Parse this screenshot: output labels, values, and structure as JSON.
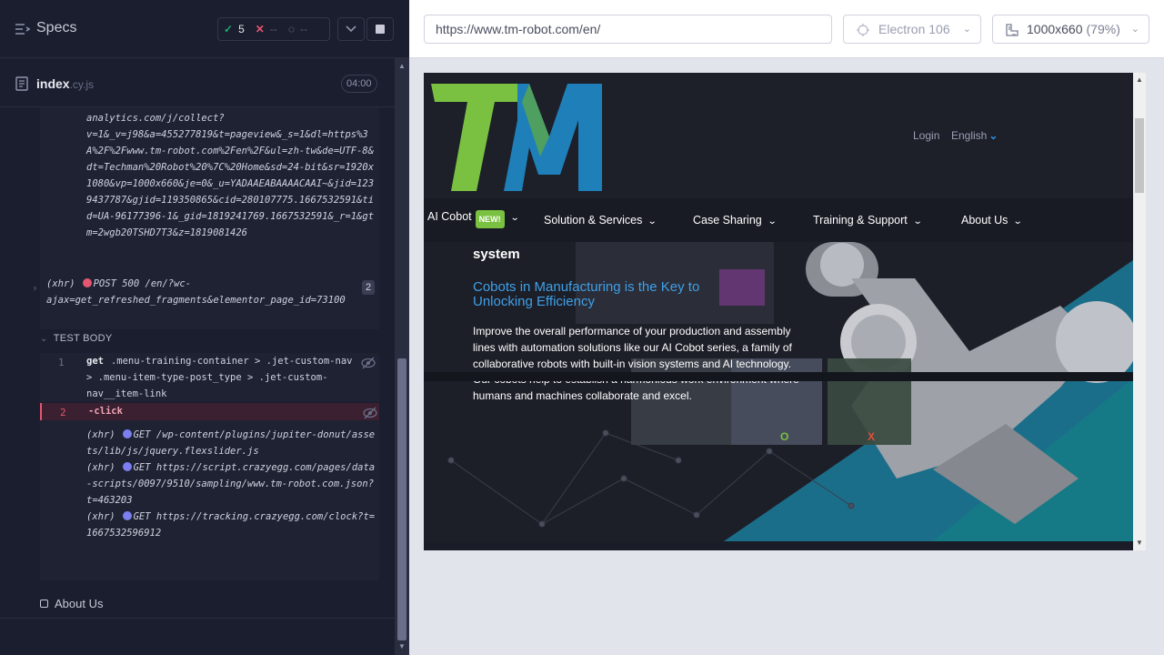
{
  "reporter": {
    "title": "Specs",
    "stats": {
      "passed": "5",
      "failed": "--",
      "pending": "--"
    },
    "file": {
      "name": "index",
      "ext": ".cy.js",
      "duration": "04:00"
    },
    "log_text": "analytics.com/j/collect?\nv=1&_v=j98&a=455277819&t=pageview&_s=1&dl=https%3A%2F%2Fwww.tm-robot.com%2Fen%2F&ul=zh-tw&de=UTF-8&dt=Techman%20Robot%20%7C%20Home&sd=24-bit&sr=1920x1080&vp=1000x660&je=0&_u=YADAAEABAAAACAAI~&jid=1239437787&gjid=119350865&cid=280107775.1667532591&tid=UA-96177396-1&_gid=1819241769.1667532591&_r=1&gtm=2wgb20TSHD7T3&z=1819081426",
    "xhr_post": {
      "prefix": "(xhr)",
      "text": "POST 500 /en/?wc-ajax=get_refreshed_fragments&elementor_page_id=73100",
      "count": "2"
    },
    "test_body_label": "TEST BODY",
    "commands": [
      {
        "num": "1",
        "name": "get",
        "message": ".menu-training-container > .jet-custom-nav > .menu-item-type-post_type > .jet-custom-nav__item-link"
      },
      {
        "num": "2",
        "name": "-click",
        "message": ""
      }
    ],
    "xhr_gets": [
      {
        "prefix": "(xhr)",
        "text": "GET /wp-content/plugins/jupiter-donut/assets/lib/js/jquery.flexslider.js"
      },
      {
        "prefix": "(xhr)",
        "text": "GET https://script.crazyegg.com/pages/data-scripts/0097/9510/sampling/www.tm-robot.com.json?t=463203"
      },
      {
        "prefix": "(xhr)",
        "text": "GET https://tracking.crazyegg.com/clock?t=1667532596912"
      }
    ],
    "suite": "About Us"
  },
  "aut": {
    "url": "https://www.tm-robot.com/en/",
    "browser": "Electron 106",
    "viewport": "1000x660",
    "scale": "(79%)"
  },
  "site": {
    "login": "Login",
    "language": "English",
    "nav": [
      {
        "label": "AI Cobot",
        "badge": "NEW!"
      },
      {
        "label": "Solution & Services"
      },
      {
        "label": "Case Sharing"
      },
      {
        "label": "Training & Support"
      },
      {
        "label": "About Us"
      }
    ],
    "hero_title_partial": "system",
    "hero_subtitle": "Cobots in Manufacturing is the Key to Unlocking Efficiency",
    "hero_description": "Improve the overall performance of your production and assembly lines with automation solutions like our AI Cobot series, a family of collaborative robots with built-in vision systems and AI technology. Our cobots help to establish a harmonious work environment where humans and machines collaborate and excel.",
    "brand_colors": {
      "green": "#7ac142",
      "blue": "#1f7fb8",
      "link_blue": "#3ea0e8"
    }
  }
}
